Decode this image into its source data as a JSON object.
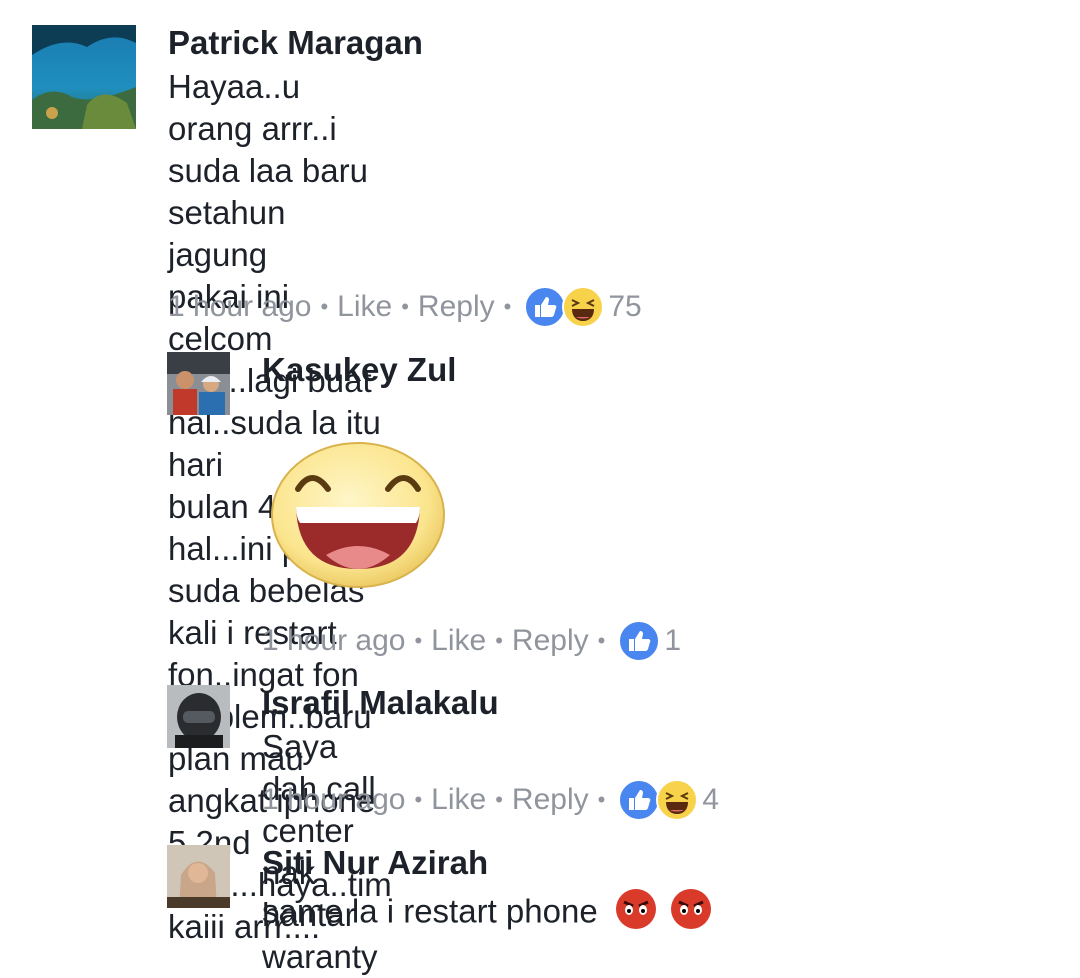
{
  "comments": [
    {
      "author": "Patrick Maragan",
      "lines": [
        "Hayaa..u orang arrr..i suda laa baru setahun jagung",
        "pakai ini celcom line...lagi buat hal..suda la itu hari",
        "bulan 4 bikin hal...ini pagi suda bebelas kali i restart",
        "fon..ingat fon problem..baru plan mau angkat iphone",
        "5 2nd tadi....haya..tim kaiii arrr...."
      ],
      "time": "1 hour ago",
      "like": "Like",
      "reply": "Reply",
      "reactions": [
        "like-icon",
        "haha-icon"
      ],
      "count": "75"
    },
    {
      "author": "Kasukey Zul",
      "sticker": "laughing-face-sticker",
      "time": "1 hour ago",
      "like": "Like",
      "reply": "Reply",
      "reactions": [
        "like-icon"
      ],
      "count": "1"
    },
    {
      "author": "Israfil Malakalu",
      "lines": [
        "Saya dah call center nak hantar waranty"
      ],
      "time": "1 hour ago",
      "like": "Like",
      "reply": "Reply",
      "reactions": [
        "like-icon",
        "haha-icon"
      ],
      "count": "4"
    },
    {
      "author": "Siti Nur Azirah",
      "lines": [
        "same la i restart phone"
      ],
      "emoji": [
        "angry-face-icon",
        "angry-face-icon"
      ]
    }
  ],
  "colors": {
    "like_blue": "#4a86f0",
    "haha_yellow": "#f7d24a",
    "meta_gray": "#90949c"
  }
}
